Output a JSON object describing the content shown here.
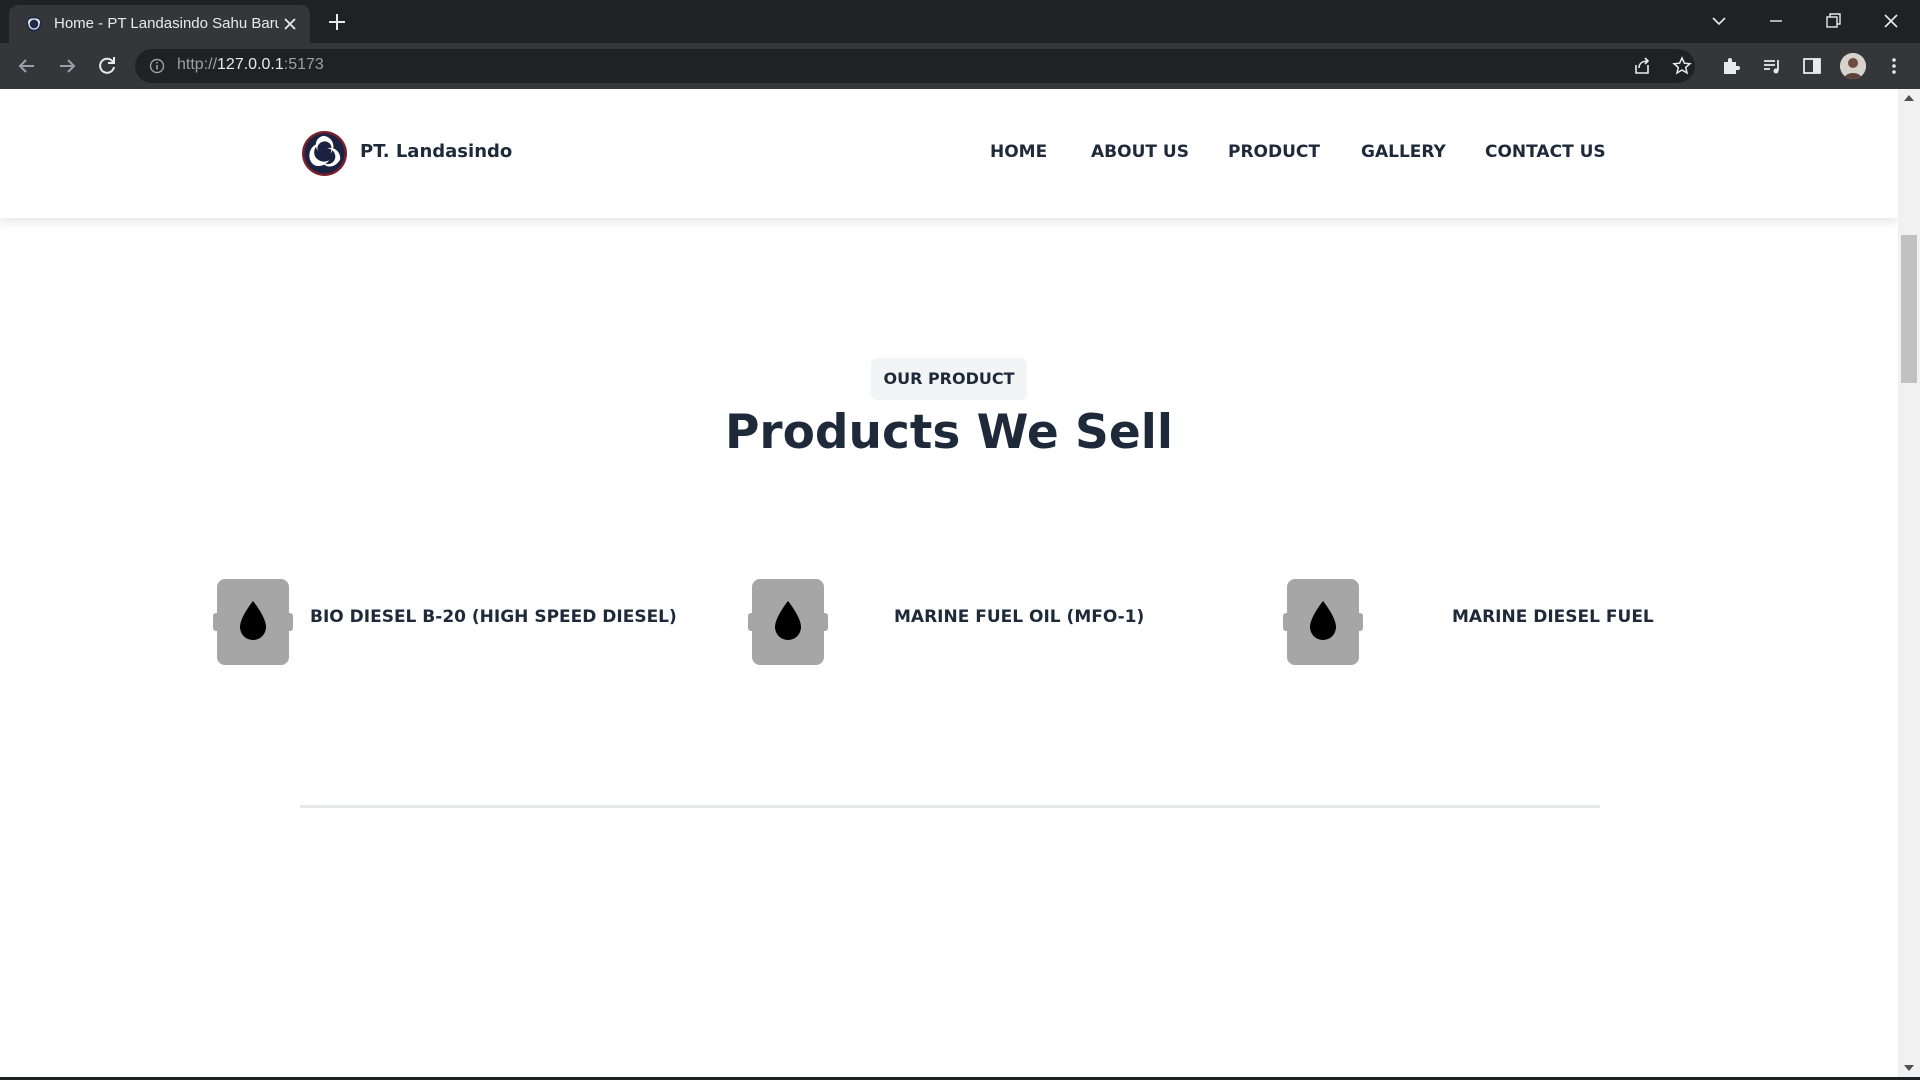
{
  "browser": {
    "tab_title": "Home - PT Landasindo Sahu Baru",
    "url_scheme": "http://",
    "url_host": "127.0.0.1",
    "url_port": ":5173",
    "icons": {
      "favicon": "logo-favicon",
      "tab_close": "close-icon",
      "new_tab": "plus-icon",
      "tab_search": "chevron-down-icon",
      "minimize": "minimize-icon",
      "restore": "restore-icon",
      "close_window": "close-icon",
      "back": "arrow-left-icon",
      "forward": "arrow-right-icon",
      "reload": "reload-icon",
      "site_info": "info-icon",
      "share": "share-icon",
      "bookmark": "star-icon",
      "extensions": "puzzle-icon",
      "media": "media-queue-icon",
      "side_panel": "side-panel-icon",
      "profile": "avatar",
      "menu": "kebab-menu-icon"
    }
  },
  "site": {
    "brand": "PT. Landasindo",
    "nav": [
      "HOME",
      "ABOUT US",
      "PRODUCT",
      "GALLERY",
      "CONTACT US"
    ],
    "section": {
      "eyebrow": "OUR PRODUCT",
      "title": "Products We Sell"
    },
    "products": [
      {
        "name": "BIO DIESEL B-20 (HIGH SPEED DIESEL)",
        "icon": "oil-barrel-icon"
      },
      {
        "name": "MARINE FUEL OIL (MFO-1)",
        "icon": "oil-barrel-icon"
      },
      {
        "name": "MARINE DIESEL FUEL",
        "icon": "oil-barrel-icon"
      }
    ]
  },
  "colors": {
    "chrome_dark": "#202124",
    "chrome_toolbar": "#35363a",
    "text_primary": "#1e2a3a",
    "product_icon": "#a6a6a6",
    "divider": "#e5e7eb"
  }
}
